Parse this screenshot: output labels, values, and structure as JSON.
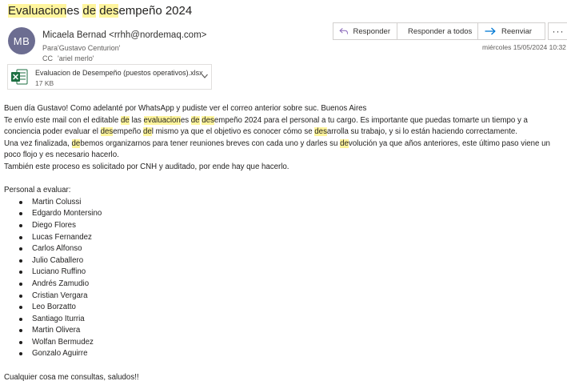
{
  "subject": {
    "p1": "Evaluacion",
    "p2": "es ",
    "p3": "de",
    "p4": " ",
    "p5": "des",
    "p6": "empeño 2024"
  },
  "avatar_initials": "MB",
  "sender": "Micaela Bernad <rrhh@nordemaq.com>",
  "to": {
    "label": "Para",
    "value": "'Gustavo Centurion'"
  },
  "cc": {
    "label": "CC",
    "value": "'ariel merlo'"
  },
  "actions": {
    "reply": "Responder",
    "reply_all": "Responder a todos",
    "forward": "Reenviar",
    "more": "···"
  },
  "date": "miércoles 15/05/2024 10:32",
  "attachment": {
    "name": "Evaluacion de Desempeño (puestos operativos).xlsx",
    "size": "17 KB",
    "icon": "excel-file-icon"
  },
  "body": {
    "greeting": "Buen día Gustavo! Como adelanté por WhatsApp y pudiste ver el correo anterior sobre suc. Buenos Aires",
    "para1": {
      "a": "Te envío este mail con el editable ",
      "b": "de",
      "c": " las ",
      "d": "evaluacion",
      "e": "es ",
      "f": "de",
      "g": " ",
      "h": "des",
      "i": "empeño 2024 para el personal a tu cargo. Es importante que puedas tomarte un tiempo y a conciencia poder evaluar el ",
      "j": "des",
      "k": "empeño ",
      "l": "de",
      "m": "l mismo ya que el objetivo es conocer cómo se ",
      "n": "des",
      "o": "arrolla su trabajo, y si lo están haciendo correctamente."
    },
    "para2": {
      "a": "Una vez finalizada, ",
      "b": "de",
      "c": "bemos organizarnos para tener reuniones breves con cada uno y darles su ",
      "d": "de",
      "e": "volución ya que años anteriores, este último paso viene un poco flojo y es necesario hacerlo."
    },
    "para3": "También este proceso es solicitado por CNH y auditado, por ende hay que hacerlo.",
    "list_title": "Personal a evaluar:",
    "personnel": [
      "Martin Colussi",
      "Edgardo Montersino",
      "Diego Flores",
      "Lucas Fernandez",
      "Carlos Alfonso",
      "Julio Caballero",
      "Luciano Ruffino",
      "Andrés Zamudio",
      "Cristian Vergara",
      "Leo Borzatto",
      "Santiago Iturria",
      "Martin Olivera",
      "Wolfan Bermudez",
      "Gonzalo Aguirre"
    ],
    "closing": "Cualquier cosa me consultas, saludos!!"
  },
  "colors": {
    "highlight": "#fff59d",
    "accent": "#0078d4",
    "reply_icon": "#8764b8",
    "avatar_bg": "#6c6d91",
    "excel_green": "#1d6f42"
  }
}
